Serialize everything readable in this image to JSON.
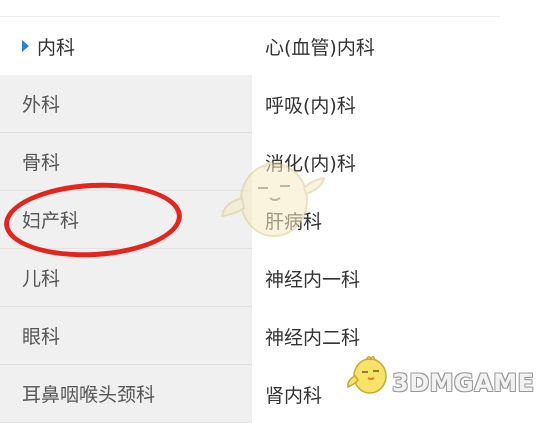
{
  "departments": [
    {
      "label": "内科",
      "active": true
    },
    {
      "label": "外科",
      "active": false
    },
    {
      "label": "骨科",
      "active": false
    },
    {
      "label": "妇产科",
      "active": false
    },
    {
      "label": "儿科",
      "active": false
    },
    {
      "label": "眼科",
      "active": false
    },
    {
      "label": "耳鼻咽喉头颈科",
      "active": false
    }
  ],
  "sub_departments": [
    {
      "label": "心(血管)内科"
    },
    {
      "label": "呼吸(内)科"
    },
    {
      "label": "消化(内)科"
    },
    {
      "label": "肝病科"
    },
    {
      "label": "神经内一科"
    },
    {
      "label": "神经内二科"
    },
    {
      "label": "肾内科"
    }
  ],
  "watermark": {
    "brand_text": "3DMGAME"
  },
  "colors": {
    "left_panel_bg": "#f0f0f0",
    "active_arrow": "#2a7de1",
    "annotation_circle": "#e5241c"
  },
  "icons": {
    "active_marker": "triangle-right-icon",
    "watermark_mascot": "chick-mascot-icon"
  }
}
